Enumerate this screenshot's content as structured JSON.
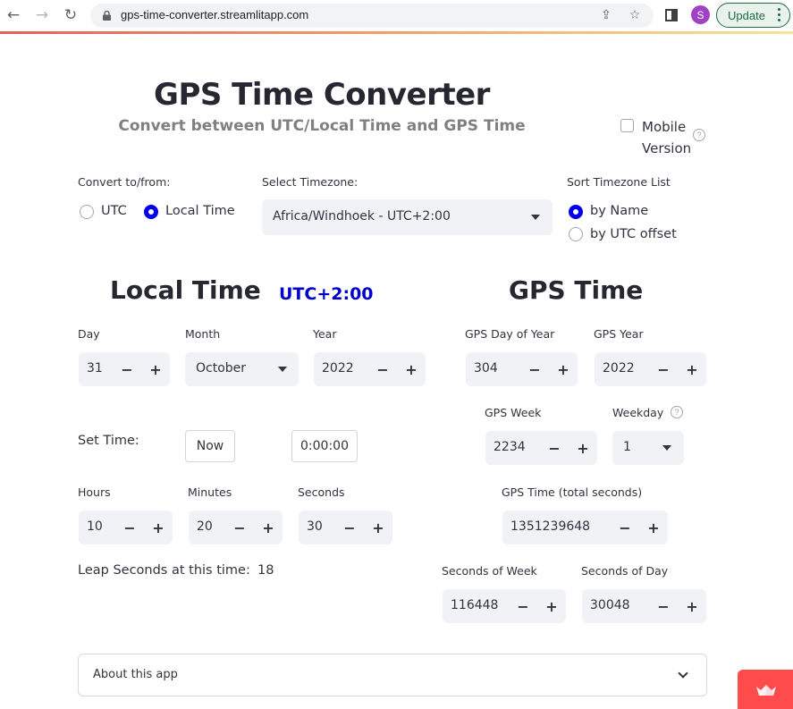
{
  "browser": {
    "url": "gps-time-converter.streamlitapp.com",
    "profile_initial": "S",
    "update_label": "Update",
    "icons": [
      "back-icon",
      "forward-icon",
      "reload-icon",
      "lock-icon",
      "share-icon",
      "star-icon",
      "side-panel-icon",
      "menu-dots-icon"
    ],
    "glyphs": {
      "back": "←",
      "forward": "→",
      "reload": "↻",
      "share": "⇪",
      "star": "☆"
    }
  },
  "app": {
    "title": "GPS Time Converter",
    "subtitle": "Convert between UTC/Local Time and GPS Time",
    "mobile_version": {
      "label_line1": "Mobile",
      "label_line2": "Version",
      "checked": false,
      "help": "?"
    },
    "convert": {
      "label": "Convert to/from:",
      "options": [
        "UTC",
        "Local Time"
      ],
      "selected": "Local Time"
    },
    "timezone": {
      "label": "Select Timezone:",
      "value": "Africa/Windhoek - UTC+2:00"
    },
    "sort": {
      "label": "Sort Timezone List",
      "options": [
        "by Name",
        "by UTC offset"
      ],
      "selected": "by Name"
    },
    "local": {
      "heading": "Local Time",
      "offset": "UTC+2:00",
      "day": {
        "label": "Day",
        "value": "31"
      },
      "month": {
        "label": "Month",
        "value": "October"
      },
      "year": {
        "label": "Year",
        "value": "2022"
      },
      "set_time_label": "Set Time:",
      "now_button": "Now",
      "midnight_button": "0:00:00",
      "hours": {
        "label": "Hours",
        "value": "10"
      },
      "minutes": {
        "label": "Minutes",
        "value": "20"
      },
      "seconds": {
        "label": "Seconds",
        "value": "30"
      },
      "leap_label": "Leap Seconds at this time:",
      "leap_value": "18"
    },
    "gps": {
      "heading": "GPS Time",
      "day_of_year": {
        "label": "GPS Day of Year",
        "value": "304"
      },
      "gps_year": {
        "label": "GPS Year",
        "value": "2022"
      },
      "week": {
        "label": "GPS Week",
        "value": "2234"
      },
      "weekday": {
        "label": "Weekday",
        "value": "1",
        "help": "?"
      },
      "total_seconds": {
        "label": "GPS Time (total seconds)",
        "value": "1351239648"
      },
      "seconds_of_week": {
        "label": "Seconds of Week",
        "value": "116448"
      },
      "seconds_of_day": {
        "label": "Seconds of Day",
        "value": "30048"
      }
    },
    "stepper": {
      "minus": "−",
      "plus": "+"
    },
    "about": {
      "label": "About this app"
    }
  },
  "colors": {
    "accent_radio": "#0000ee",
    "utc_tag": "#0000cc",
    "widget_bg": "#f0f2f6",
    "streamlit_red": "#ff4b4b",
    "profile": "#a142c6"
  }
}
